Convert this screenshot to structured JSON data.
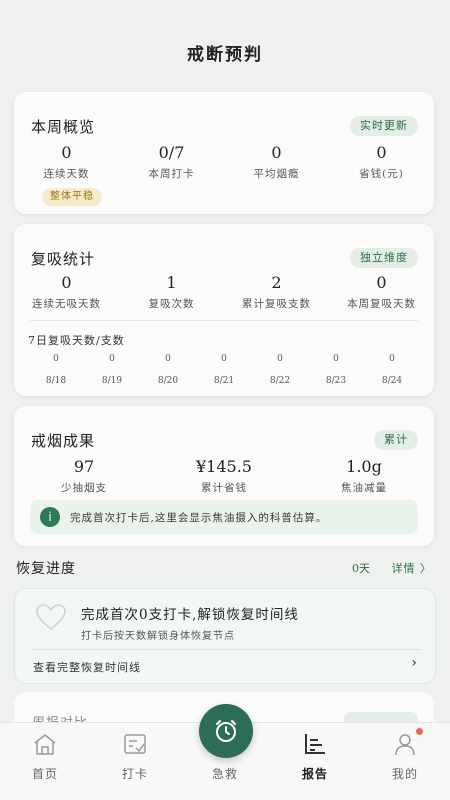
{
  "header": {
    "title": "戒断预判"
  },
  "weekly": {
    "title": "本周概览",
    "tag": "实时更新",
    "stats": [
      {
        "value": "0",
        "label": "连续天数"
      },
      {
        "value": "0/7",
        "label": "本周打卡"
      },
      {
        "value": "0",
        "label": "平均烟瘾"
      },
      {
        "value": "0",
        "label": "省钱(元)"
      }
    ],
    "badge": "整体平稳"
  },
  "relapse": {
    "title": "复吸统计",
    "tag": "独立维度",
    "stats": [
      {
        "value": "0",
        "label": "连续无吸天数"
      },
      {
        "value": "1",
        "label": "复吸次数"
      },
      {
        "value": "2",
        "label": "累计复吸支数"
      },
      {
        "value": "0",
        "label": "本周复吸天数"
      }
    ],
    "days_title": "7日复吸天数/支数",
    "days": [
      {
        "value": "0",
        "date": "8/18"
      },
      {
        "value": "0",
        "date": "8/19"
      },
      {
        "value": "0",
        "date": "8/20"
      },
      {
        "value": "0",
        "date": "8/21"
      },
      {
        "value": "0",
        "date": "8/22"
      },
      {
        "value": "0",
        "date": "8/23"
      },
      {
        "value": "0",
        "date": "8/24"
      }
    ]
  },
  "results": {
    "title": "戒烟成果",
    "tag": "累计",
    "stats": [
      {
        "value": "97",
        "label": "少抽烟支"
      },
      {
        "value": "¥145.5",
        "label": "累计省钱"
      },
      {
        "value": "1.0g",
        "label": "焦油减量"
      }
    ],
    "info_icon": "info-icon",
    "info": "完成首次打卡后,这里会显示焦油摄入的科普估算。"
  },
  "recovery": {
    "title": "恢复进度",
    "days": "0天",
    "detail": "详情 〉",
    "card_title": "完成首次0支打卡,解锁恢复时间线",
    "card_sub": "打卡后按天数解锁身体恢复节点",
    "link": "查看完整恢复时间线",
    "arrow": "›"
  },
  "peek": {
    "title": "周报对比"
  },
  "tabs": [
    {
      "label": "首页",
      "icon": "home-icon"
    },
    {
      "label": "打卡",
      "icon": "checkin-icon"
    },
    {
      "label": "急救",
      "icon": "alarm-clock-icon"
    },
    {
      "label": "报告",
      "icon": "report-icon"
    },
    {
      "label": "我的",
      "icon": "user-icon"
    }
  ],
  "colors": {
    "accent": "#2c6e55",
    "background": "#eef1ee",
    "badge": "#f6ecc9",
    "notification": "#e36a4f"
  }
}
